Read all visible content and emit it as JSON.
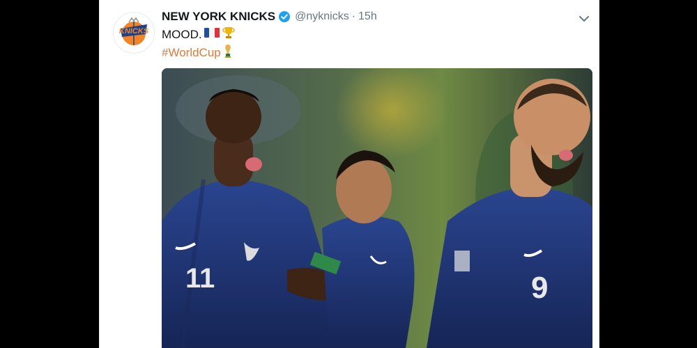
{
  "tweet": {
    "display_name": "NEW YORK KNICKS",
    "verified": true,
    "handle": "@nyknicks",
    "separator": "·",
    "time": "15h",
    "text": "MOOD.",
    "text_emojis": [
      "flag-france-emoji",
      "trophy-emoji"
    ],
    "hashtag": "#WorldCup",
    "hashtag_icon": "world-cup-trophy-icon",
    "avatar": {
      "logo_text": "KNICKS",
      "icon": "knicks-logo"
    },
    "menu_icon": "chevron-down-icon"
  },
  "media": {
    "description_icon": "photo-three-france-players-celebrating",
    "jersey_numbers": [
      "11",
      "9"
    ],
    "colors": {
      "jersey": "#1d2f6a",
      "accent": "#e07a3a",
      "hashtag": "#e07a3a",
      "verified": "#1da1f2"
    }
  }
}
